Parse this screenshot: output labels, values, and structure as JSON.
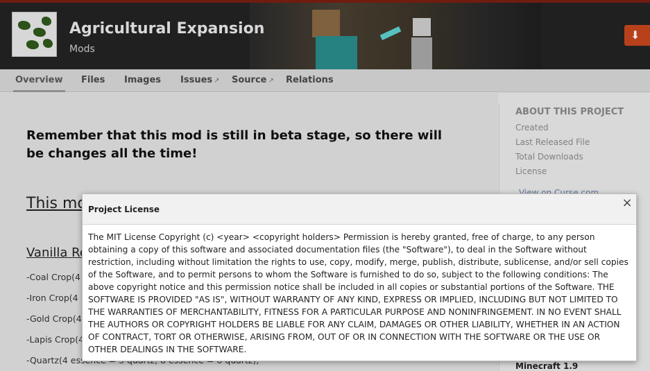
{
  "header": {
    "title": "Agricultural Expansion",
    "subtitle": "Mods",
    "download_icon": "download-arrow-icon"
  },
  "nav": {
    "tabs": [
      {
        "label": "Overview",
        "active": true
      },
      {
        "label": "Files"
      },
      {
        "label": "Images"
      },
      {
        "label": "Issues",
        "external": true
      },
      {
        "label": "Source",
        "external": true
      },
      {
        "label": "Relations"
      }
    ],
    "external_icon": "external-link-icon"
  },
  "content": {
    "notice": "Remember that this mod is still in beta stage, so there will be changes all the time!",
    "heading_partial": "This mo",
    "vanilla_heading": "Vanilla Re",
    "crops": [
      "-Coal Crop(4",
      "-Iron Crop(4",
      "-Gold Crop(4",
      "-Lapis Crop(4",
      "-Quartz(4 essence = 3 quartz, 8 essence = 6 quartz),"
    ]
  },
  "sidebar": {
    "heading": "ABOUT THIS PROJECT",
    "items": [
      "Created",
      "Last Released File",
      "Total Downloads",
      "License"
    ],
    "curse_link": "View on Curse.com",
    "minecraft": "Minecraft 1.9"
  },
  "modal": {
    "title": "Project License",
    "close_label": "×",
    "body": "The MIT License Copyright (c) <year> <copyright holders> Permission is hereby granted, free of charge, to any person obtaining a copy of this software and associated documentation files (the \"Software\"), to deal in the Software without restriction, including without limitation the rights to use, copy, modify, merge, publish, distribute, sublicense, and/or sell copies of the Software, and to permit persons to whom the Software is furnished to do so, subject to the following conditions: The above copyright notice and this permission notice shall be included in all copies or substantial portions of the Software. THE SOFTWARE IS PROVIDED \"AS IS\", WITHOUT WARRANTY OF ANY KIND, EXPRESS OR IMPLIED, INCLUDING BUT NOT LIMITED TO THE WARRANTIES OF MERCHANTABILITY, FITNESS FOR A PARTICULAR PURPOSE AND NONINFRINGEMENT. IN NO EVENT SHALL THE AUTHORS OR COPYRIGHT HOLDERS BE LIABLE FOR ANY CLAIM, DAMAGES OR OTHER LIABILITY, WHETHER IN AN ACTION OF CONTRACT, TORT OR OTHERWISE, ARISING FROM, OUT OF OR IN CONNECTION WITH THE SOFTWARE OR THE USE OR OTHER DEALINGS IN THE SOFTWARE."
  },
  "colors": {
    "accent": "#c8471f",
    "header_bg": "#232323",
    "nav_bg": "#d9d9d9"
  }
}
